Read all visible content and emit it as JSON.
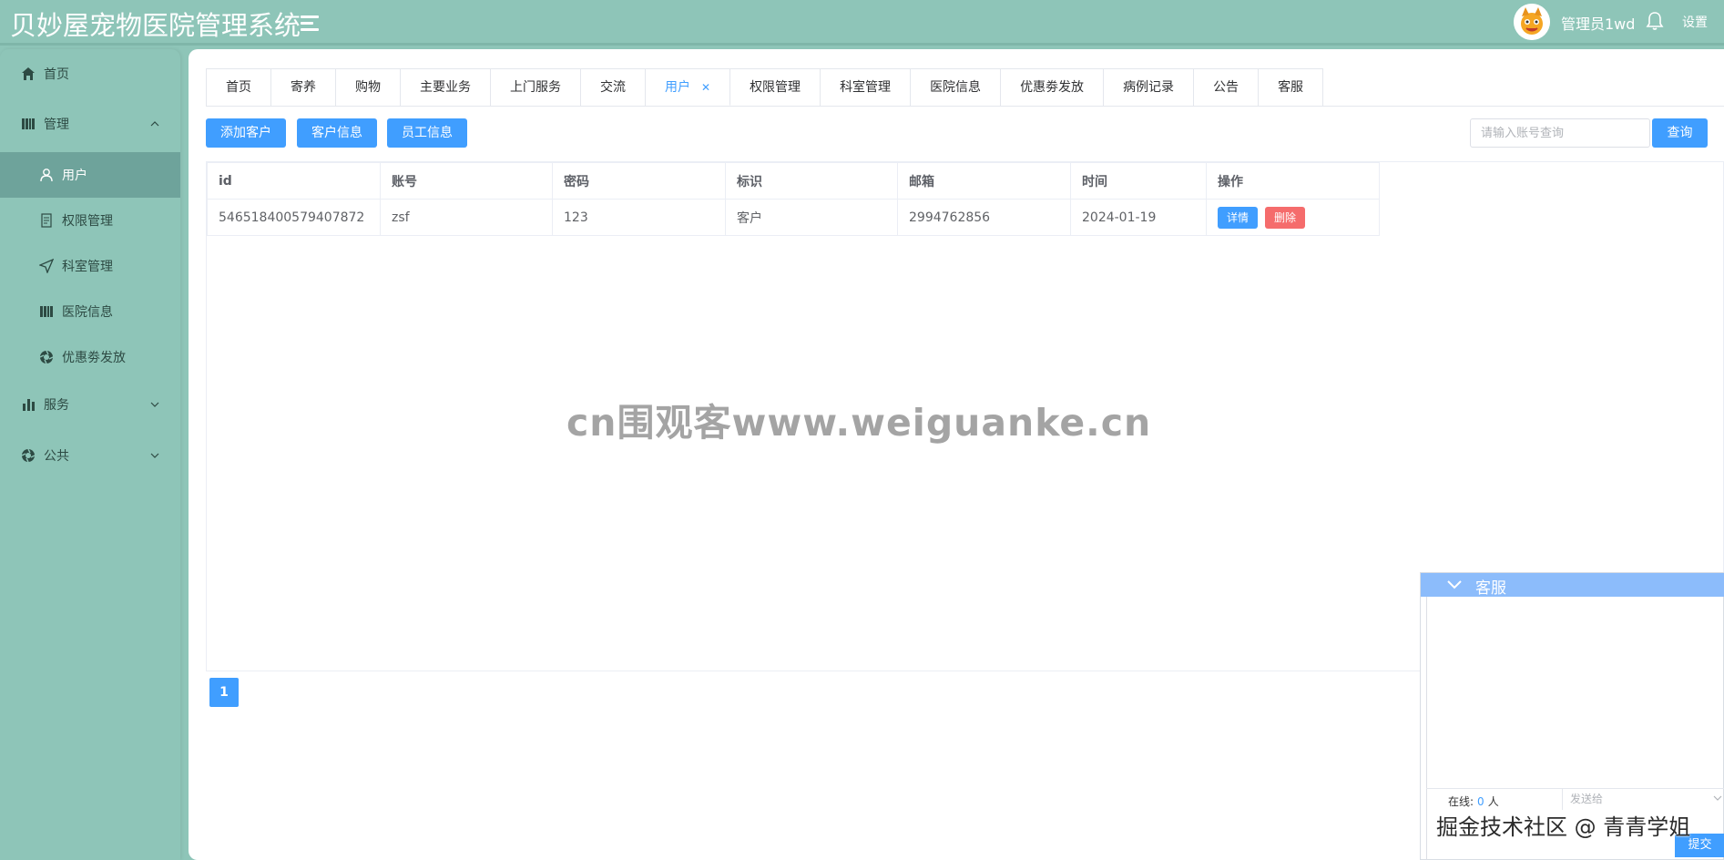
{
  "header": {
    "app_title": "贝妙屋宠物医院管理系统",
    "username": "管理员1wd",
    "settings_label": "设置"
  },
  "sidebar": {
    "home": "首页",
    "manage": "管理",
    "items": [
      {
        "label": "用户",
        "icon": "user-icon"
      },
      {
        "label": "权限管理",
        "icon": "document-icon"
      },
      {
        "label": "科室管理",
        "icon": "send-icon"
      },
      {
        "label": "医院信息",
        "icon": "book-icon"
      },
      {
        "label": "优惠劵发放",
        "icon": "aperture-icon"
      }
    ],
    "service": "服务",
    "public": "公共"
  },
  "tabs": [
    "首页",
    "寄养",
    "购物",
    "主要业务",
    "上门服务",
    "交流",
    "用户",
    "权限管理",
    "科室管理",
    "医院信息",
    "优惠劵发放",
    "病例记录",
    "公告",
    "客服"
  ],
  "active_tab": "用户",
  "toolbar": {
    "add_customer": "添加客户",
    "customer_info": "客户信息",
    "staff_info": "员工信息",
    "search_placeholder": "请输入账号查询",
    "search_button": "查询"
  },
  "table": {
    "headers": [
      "id",
      "账号",
      "密码",
      "标识",
      "邮箱",
      "时间",
      "操作"
    ],
    "rows": [
      {
        "id": "546518400579407872",
        "account": "zsf",
        "password": "123",
        "role": "客户",
        "email": "2994762856",
        "time": "2024-01-19",
        "detail_button": "详情",
        "delete_button": "删除"
      }
    ]
  },
  "pagination": {
    "current_page": "1"
  },
  "watermark": "cn围观客www.weiguanke.cn",
  "chat": {
    "title": "客服",
    "online_label": "在线:",
    "online_count": "0",
    "online_unit": "人",
    "send_to_placeholder": "发送给",
    "submit": "提交"
  },
  "juejin_watermark": "掘金技术社区 @ 青青学姐",
  "colors": {
    "theme": "#8ec5b8",
    "active_menu": "#6ea39b",
    "primary": "#409eff",
    "danger": "#f56c6c",
    "chat_header": "#8cbcfb"
  }
}
